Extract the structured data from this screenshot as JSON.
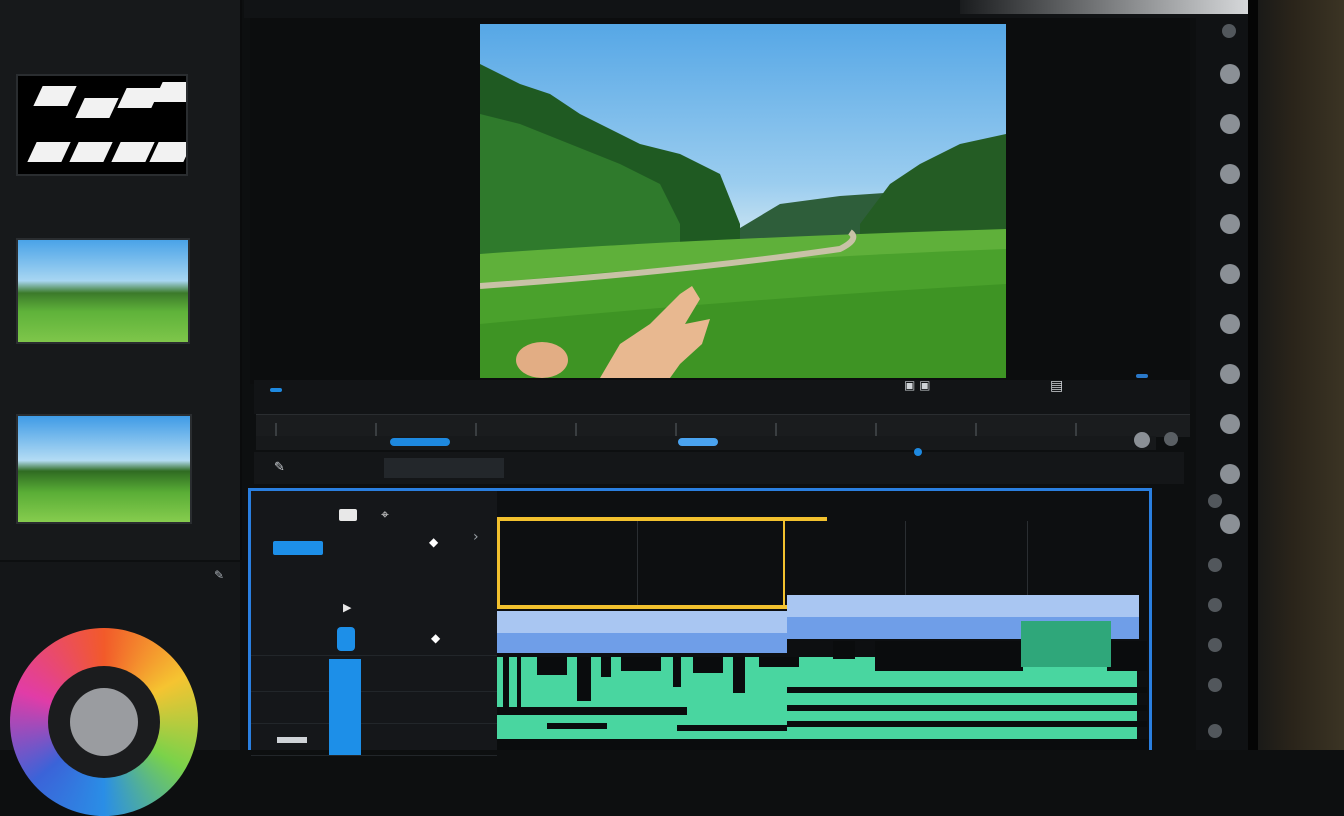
{
  "bin": {
    "header": "",
    "sub_header": "",
    "clip1": {
      "label": "",
      "meta_left": "",
      "meta_right": ""
    },
    "clip2": {
      "label": "",
      "meta_left": "",
      "meta_right": ""
    },
    "clip3": {
      "label": "",
      "meta_left": "",
      "meta_right": ""
    }
  },
  "color_panel": {
    "title": "",
    "value": ""
  },
  "viewer": {
    "title": ""
  },
  "transport": {
    "timecode": "",
    "clip_name": "",
    "center_info": "",
    "zoom": ""
  },
  "toolbar": {
    "items": [
      "",
      "",
      "",
      "",
      "",
      ""
    ]
  },
  "timeline": {
    "track_header_label": "",
    "track_values": [
      "",
      "",
      "",
      ""
    ],
    "track_names": [
      "",
      "",
      ""
    ],
    "lane_labels": [
      "",
      "",
      "",
      "",
      ""
    ],
    "clip_labels": [
      "",
      ""
    ]
  },
  "colors": {
    "accent_blue": "#1e89e0",
    "timeline_border": "#2a7fe0",
    "audio_green": "#49d6a0",
    "playhead_yellow": "#f2c12e"
  }
}
